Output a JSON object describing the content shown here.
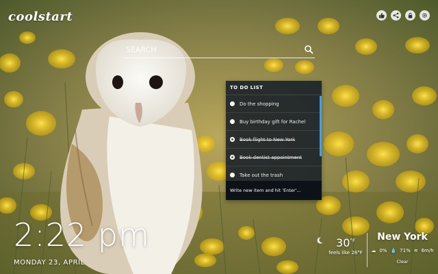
{
  "app": {
    "logo": "coolstart"
  },
  "top_icons": [
    {
      "name": "thumbs-up-icon"
    },
    {
      "name": "share-icon"
    },
    {
      "name": "lock-icon"
    },
    {
      "name": "gear-icon"
    }
  ],
  "search": {
    "placeholder": "SEARCH"
  },
  "todo": {
    "title": "TO DO LIST",
    "items": [
      {
        "label": "Do the shopping",
        "done": false
      },
      {
        "label": "Buy birthday gift for Rachel",
        "done": false
      },
      {
        "label": "Book flight to New York",
        "done": true
      },
      {
        "label": "Book dentist appointment",
        "done": true
      },
      {
        "label": "Take out the trash",
        "done": false
      }
    ],
    "input_placeholder": "Write new item and hit 'Enter'...",
    "accent_color": "#3fa2e8"
  },
  "clock": {
    "time": "2:22 pm",
    "date": "MONDAY 23, APRIL"
  },
  "weather": {
    "temp": "30",
    "unit": "°F",
    "feels_like": "feels like 28°F",
    "city": "New York",
    "precip": "0%",
    "humidity": "71%",
    "wind": "6m/h",
    "condition": "Clear"
  }
}
